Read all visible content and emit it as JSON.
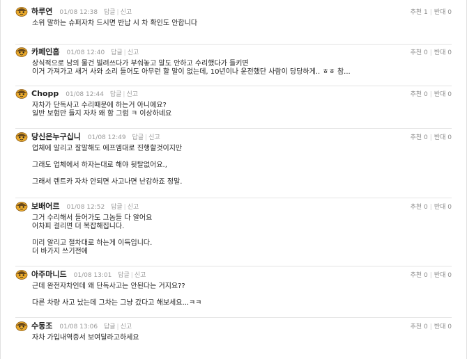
{
  "comments": [
    {
      "nickname": "하루연",
      "datetime": "01/08 12:38",
      "reply": "답글",
      "report": "신고",
      "recommend": "추천 1",
      "oppose": "반대 0",
      "lines": [
        "소위 말하는 슈퍼자차 드시면 반납 시 차 확인도 안합니다"
      ]
    },
    {
      "nickname": "카페인홈",
      "datetime": "01/08 12:40",
      "reply": "답글",
      "report": "신고",
      "recommend": "추천 0",
      "oppose": "반대 0",
      "lines": [
        "상식적으로 남의 물건 빌려쓰다가 부숴놓고 말도 안하고 수리했다가 들키면",
        "이거 가져가고 새거 사와 소리 들어도 아무런 할 말이 없는데, 10년이나 운전했단 사람이 당당하게.. ㅎㅎ 참..."
      ]
    },
    {
      "nickname": "Chopp",
      "datetime": "01/08 12:44",
      "reply": "답글",
      "report": "신고",
      "recommend": "추천 0",
      "oppose": "반대 0",
      "lines": [
        "자차가 단독사고 수리때문에 하는거 아니에요?",
        "일반 보험만 들지 자차 왜 함 그럼 ㅋ 이상하네요"
      ]
    },
    {
      "nickname": "당신은누구십니",
      "datetime": "01/08 12:49",
      "reply": "답글",
      "report": "신고",
      "recommend": "추천 0",
      "oppose": "반대 0",
      "lines": [
        "업체에 알리고 잘말해도 에프엠대로 진행할것이지만",
        "",
        "그래도 업체에서 하자는대로 해야 뒷탈없어요.,",
        "",
        "그래서 렌트카 자차 안되면 사고나면 난감하죠 정말."
      ]
    },
    {
      "nickname": "보배어르",
      "datetime": "01/08 12:52",
      "reply": "답글",
      "report": "신고",
      "recommend": "추천 0",
      "oppose": "반대 0",
      "lines": [
        "그거 수리해서 들어가도 그놈들 다 알어요",
        "어차피 걸리면 더 복잡해집니다.",
        "",
        "미리 알리고 절차대로 하는게 이득입니다.",
        "더 바가지 쓰기전에"
      ]
    },
    {
      "nickname": "아주마니드",
      "datetime": "01/08 13:01",
      "reply": "답글",
      "report": "신고",
      "recommend": "추천 0",
      "oppose": "반대 0",
      "lines": [
        "근데 완전자차인데 왜 단독사고는 안된다는 거지요??",
        "",
        "다른 차량 사고 났는데 그차는 그냥 갔다고 해보세요...ㅋㅋ"
      ]
    },
    {
      "nickname": "수동조",
      "datetime": "01/08 13:06",
      "reply": "답글",
      "report": "신고",
      "recommend": "추천 0",
      "oppose": "반대 0",
      "lines": [
        "자차 가입내역증서 보여달라고하세요"
      ]
    }
  ],
  "avatar_icon": "helmet-face-icon",
  "colors": {
    "text": "#222222",
    "meta": "#999999",
    "border": "#e3e3e3",
    "avatar": "#e9a92c"
  }
}
